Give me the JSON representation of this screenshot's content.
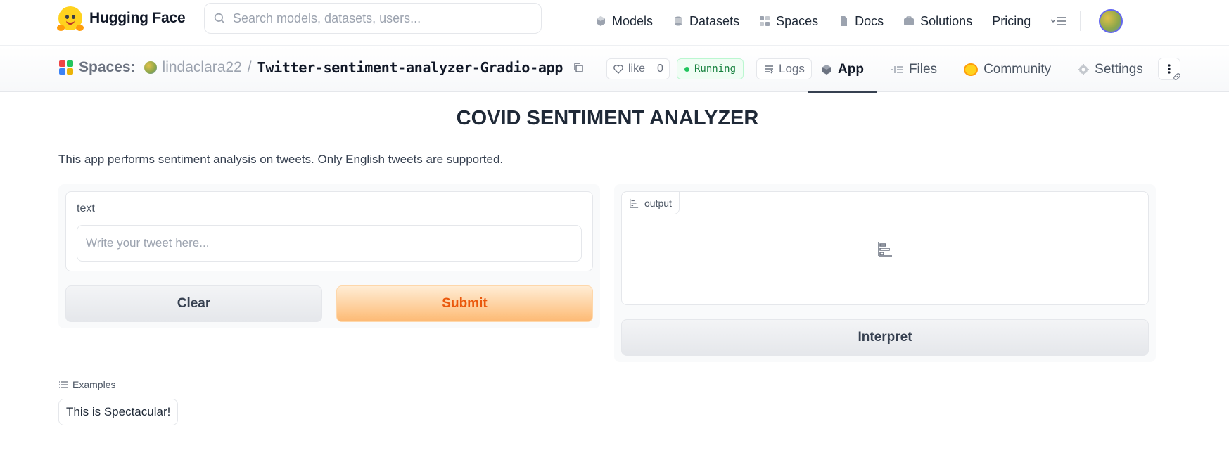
{
  "navbar": {
    "brand": "Hugging Face",
    "search_placeholder": "Search models, datasets, users...",
    "items": [
      {
        "label": "Models",
        "icon": "models-icon"
      },
      {
        "label": "Datasets",
        "icon": "datasets-icon"
      },
      {
        "label": "Spaces",
        "icon": "spaces-icon"
      },
      {
        "label": "Docs",
        "icon": "docs-icon"
      },
      {
        "label": "Solutions",
        "icon": "solutions-icon"
      },
      {
        "label": "Pricing",
        "icon": ""
      }
    ]
  },
  "space_header": {
    "section_label": "Spaces:",
    "owner": "lindaclara22",
    "separator": "/",
    "repo_name": "Twitter-sentiment-analyzer-Gradio-app",
    "like_label": "like",
    "like_count": "0",
    "status": "Running",
    "logs_label": "Logs",
    "tabs": [
      {
        "label": "App",
        "active": true
      },
      {
        "label": "Files",
        "active": false
      },
      {
        "label": "Community",
        "active": false
      },
      {
        "label": "Settings",
        "active": false
      }
    ]
  },
  "app": {
    "title": "COVID SENTIMENT ANALYZER",
    "description": "This app performs sentiment analysis on tweets. Only English tweets are supported.",
    "input": {
      "label": "text",
      "placeholder": "Write your tweet here...",
      "value": ""
    },
    "buttons": {
      "clear": "Clear",
      "submit": "Submit",
      "interpret": "Interpret"
    },
    "output": {
      "label": "output"
    },
    "examples": {
      "label": "Examples",
      "items": [
        "This is Spectacular!"
      ]
    }
  },
  "colors": {
    "accent_orange": "#ea580c",
    "running_green": "#22c55e",
    "brand_yellow": "#ffd21e"
  }
}
